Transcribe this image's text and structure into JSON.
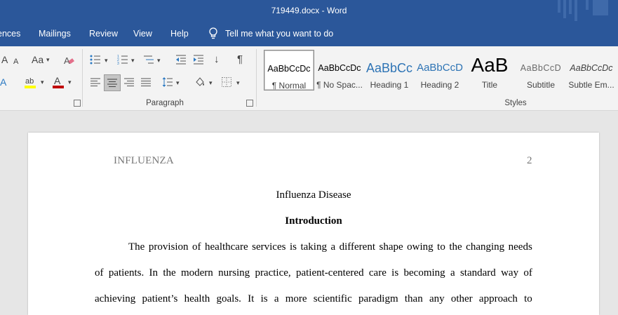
{
  "window": {
    "title": "719449.docx  -  Word"
  },
  "menu": {
    "tabs": [
      "ences",
      "Mailings",
      "Review",
      "View",
      "Help"
    ],
    "tell_me": "Tell me what you want to do"
  },
  "ribbon": {
    "font_group": {
      "grow_font_glyph": "A",
      "shrink_font_glyph": "A",
      "change_case_glyph": "Aa"
    },
    "paragraph_group": {
      "label": "Paragraph",
      "show_marks_glyph": "¶"
    },
    "styles_group": {
      "label": "Styles",
      "items": [
        {
          "sample": "AaBbCcDc",
          "name": "¶ Normal"
        },
        {
          "sample": "AaBbCcDc",
          "name": "¶ No Spac..."
        },
        {
          "sample": "AaBbCc",
          "name": "Heading 1"
        },
        {
          "sample": "AaBbCcD",
          "name": "Heading 2"
        },
        {
          "sample": "AaB",
          "name": "Title"
        },
        {
          "sample": "AaBbCcD",
          "name": "Subtitle"
        },
        {
          "sample": "AaBbCcDc",
          "name": "Subtle Em..."
        }
      ]
    },
    "colors": {
      "highlight": "#ffff00",
      "font_color": "#c00000",
      "accent": "#2b579a"
    }
  },
  "document": {
    "header_left": "INFLUENZA",
    "header_page_number": "2",
    "title": "Influenza Disease",
    "heading": "Introduction",
    "lines": [
      "The provision of healthcare services is taking a different shape owing to the changing needs",
      "of patients. In the modern nursing practice, patient-centered care is becoming a standard way of",
      "achieving patient’s health goals. It is a more scientific paradigm than any other approach to"
    ]
  }
}
